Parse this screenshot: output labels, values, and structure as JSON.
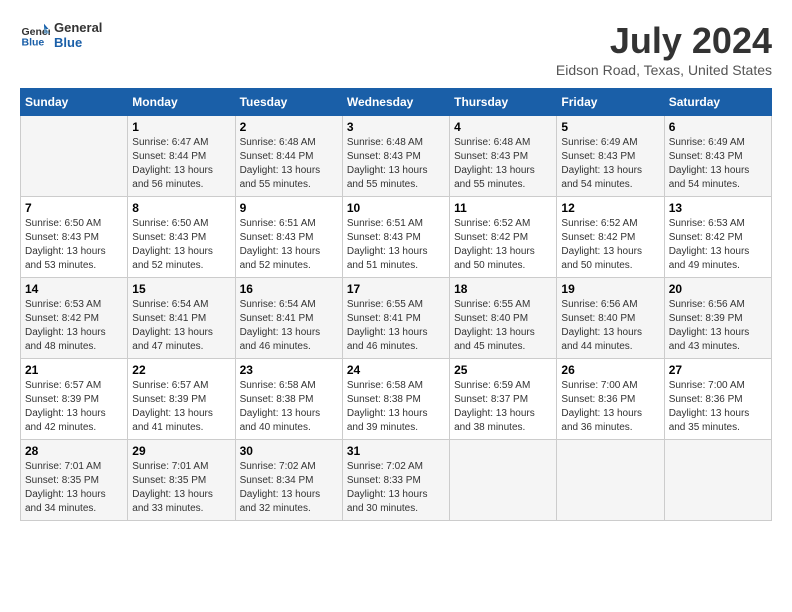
{
  "header": {
    "logo_line1": "General",
    "logo_line2": "Blue",
    "title": "July 2024",
    "location": "Eidson Road, Texas, United States"
  },
  "calendar": {
    "days_of_week": [
      "Sunday",
      "Monday",
      "Tuesday",
      "Wednesday",
      "Thursday",
      "Friday",
      "Saturday"
    ],
    "weeks": [
      [
        {
          "day": "",
          "sunrise": "",
          "sunset": "",
          "daylight": ""
        },
        {
          "day": "1",
          "sunrise": "Sunrise: 6:47 AM",
          "sunset": "Sunset: 8:44 PM",
          "daylight": "Daylight: 13 hours and 56 minutes."
        },
        {
          "day": "2",
          "sunrise": "Sunrise: 6:48 AM",
          "sunset": "Sunset: 8:44 PM",
          "daylight": "Daylight: 13 hours and 55 minutes."
        },
        {
          "day": "3",
          "sunrise": "Sunrise: 6:48 AM",
          "sunset": "Sunset: 8:43 PM",
          "daylight": "Daylight: 13 hours and 55 minutes."
        },
        {
          "day": "4",
          "sunrise": "Sunrise: 6:48 AM",
          "sunset": "Sunset: 8:43 PM",
          "daylight": "Daylight: 13 hours and 55 minutes."
        },
        {
          "day": "5",
          "sunrise": "Sunrise: 6:49 AM",
          "sunset": "Sunset: 8:43 PM",
          "daylight": "Daylight: 13 hours and 54 minutes."
        },
        {
          "day": "6",
          "sunrise": "Sunrise: 6:49 AM",
          "sunset": "Sunset: 8:43 PM",
          "daylight": "Daylight: 13 hours and 54 minutes."
        }
      ],
      [
        {
          "day": "7",
          "sunrise": "Sunrise: 6:50 AM",
          "sunset": "Sunset: 8:43 PM",
          "daylight": "Daylight: 13 hours and 53 minutes."
        },
        {
          "day": "8",
          "sunrise": "Sunrise: 6:50 AM",
          "sunset": "Sunset: 8:43 PM",
          "daylight": "Daylight: 13 hours and 52 minutes."
        },
        {
          "day": "9",
          "sunrise": "Sunrise: 6:51 AM",
          "sunset": "Sunset: 8:43 PM",
          "daylight": "Daylight: 13 hours and 52 minutes."
        },
        {
          "day": "10",
          "sunrise": "Sunrise: 6:51 AM",
          "sunset": "Sunset: 8:43 PM",
          "daylight": "Daylight: 13 hours and 51 minutes."
        },
        {
          "day": "11",
          "sunrise": "Sunrise: 6:52 AM",
          "sunset": "Sunset: 8:42 PM",
          "daylight": "Daylight: 13 hours and 50 minutes."
        },
        {
          "day": "12",
          "sunrise": "Sunrise: 6:52 AM",
          "sunset": "Sunset: 8:42 PM",
          "daylight": "Daylight: 13 hours and 50 minutes."
        },
        {
          "day": "13",
          "sunrise": "Sunrise: 6:53 AM",
          "sunset": "Sunset: 8:42 PM",
          "daylight": "Daylight: 13 hours and 49 minutes."
        }
      ],
      [
        {
          "day": "14",
          "sunrise": "Sunrise: 6:53 AM",
          "sunset": "Sunset: 8:42 PM",
          "daylight": "Daylight: 13 hours and 48 minutes."
        },
        {
          "day": "15",
          "sunrise": "Sunrise: 6:54 AM",
          "sunset": "Sunset: 8:41 PM",
          "daylight": "Daylight: 13 hours and 47 minutes."
        },
        {
          "day": "16",
          "sunrise": "Sunrise: 6:54 AM",
          "sunset": "Sunset: 8:41 PM",
          "daylight": "Daylight: 13 hours and 46 minutes."
        },
        {
          "day": "17",
          "sunrise": "Sunrise: 6:55 AM",
          "sunset": "Sunset: 8:41 PM",
          "daylight": "Daylight: 13 hours and 46 minutes."
        },
        {
          "day": "18",
          "sunrise": "Sunrise: 6:55 AM",
          "sunset": "Sunset: 8:40 PM",
          "daylight": "Daylight: 13 hours and 45 minutes."
        },
        {
          "day": "19",
          "sunrise": "Sunrise: 6:56 AM",
          "sunset": "Sunset: 8:40 PM",
          "daylight": "Daylight: 13 hours and 44 minutes."
        },
        {
          "day": "20",
          "sunrise": "Sunrise: 6:56 AM",
          "sunset": "Sunset: 8:39 PM",
          "daylight": "Daylight: 13 hours and 43 minutes."
        }
      ],
      [
        {
          "day": "21",
          "sunrise": "Sunrise: 6:57 AM",
          "sunset": "Sunset: 8:39 PM",
          "daylight": "Daylight: 13 hours and 42 minutes."
        },
        {
          "day": "22",
          "sunrise": "Sunrise: 6:57 AM",
          "sunset": "Sunset: 8:39 PM",
          "daylight": "Daylight: 13 hours and 41 minutes."
        },
        {
          "day": "23",
          "sunrise": "Sunrise: 6:58 AM",
          "sunset": "Sunset: 8:38 PM",
          "daylight": "Daylight: 13 hours and 40 minutes."
        },
        {
          "day": "24",
          "sunrise": "Sunrise: 6:58 AM",
          "sunset": "Sunset: 8:38 PM",
          "daylight": "Daylight: 13 hours and 39 minutes."
        },
        {
          "day": "25",
          "sunrise": "Sunrise: 6:59 AM",
          "sunset": "Sunset: 8:37 PM",
          "daylight": "Daylight: 13 hours and 38 minutes."
        },
        {
          "day": "26",
          "sunrise": "Sunrise: 7:00 AM",
          "sunset": "Sunset: 8:36 PM",
          "daylight": "Daylight: 13 hours and 36 minutes."
        },
        {
          "day": "27",
          "sunrise": "Sunrise: 7:00 AM",
          "sunset": "Sunset: 8:36 PM",
          "daylight": "Daylight: 13 hours and 35 minutes."
        }
      ],
      [
        {
          "day": "28",
          "sunrise": "Sunrise: 7:01 AM",
          "sunset": "Sunset: 8:35 PM",
          "daylight": "Daylight: 13 hours and 34 minutes."
        },
        {
          "day": "29",
          "sunrise": "Sunrise: 7:01 AM",
          "sunset": "Sunset: 8:35 PM",
          "daylight": "Daylight: 13 hours and 33 minutes."
        },
        {
          "day": "30",
          "sunrise": "Sunrise: 7:02 AM",
          "sunset": "Sunset: 8:34 PM",
          "daylight": "Daylight: 13 hours and 32 minutes."
        },
        {
          "day": "31",
          "sunrise": "Sunrise: 7:02 AM",
          "sunset": "Sunset: 8:33 PM",
          "daylight": "Daylight: 13 hours and 30 minutes."
        },
        {
          "day": "",
          "sunrise": "",
          "sunset": "",
          "daylight": ""
        },
        {
          "day": "",
          "sunrise": "",
          "sunset": "",
          "daylight": ""
        },
        {
          "day": "",
          "sunrise": "",
          "sunset": "",
          "daylight": ""
        }
      ]
    ]
  }
}
